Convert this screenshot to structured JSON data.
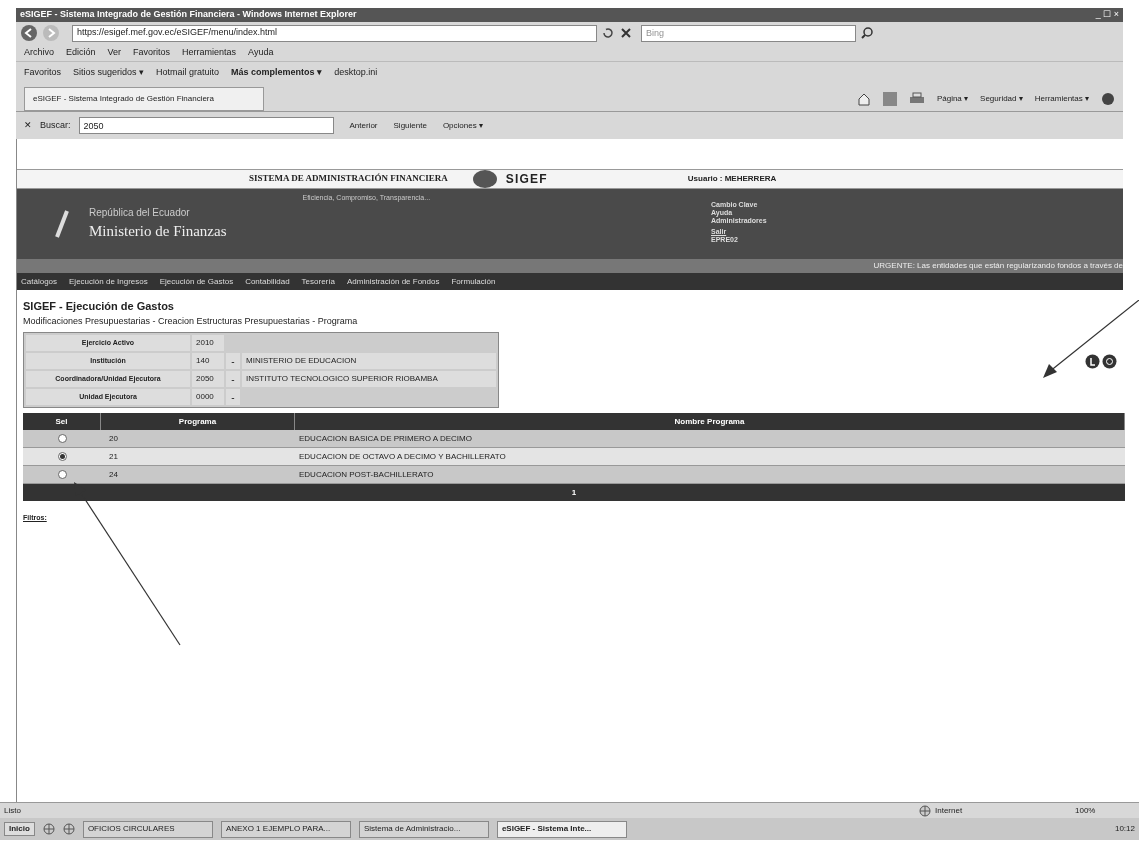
{
  "window": {
    "title": "eSIGEF - Sistema Integrado de Gestión Financiera - Windows Internet Explorer",
    "controls": "_ ☐ ×"
  },
  "address_bar": {
    "url": "https://esigef.mef.gov.ec/eSIGEF/menu/index.html",
    "search_placeholder": "Bing"
  },
  "menu": [
    "Archivo",
    "Edición",
    "Ver",
    "Favoritos",
    "Herramientas",
    "Ayuda"
  ],
  "favorites_bar": {
    "label": "Favoritos",
    "links": [
      {
        "label": "Sitios sugeridos ▾",
        "bold": false
      },
      {
        "label": "Hotmail gratuito",
        "bold": false
      },
      {
        "label": "Más complementos ▾",
        "bold": true
      },
      {
        "label": "desktop.ini",
        "bold": false
      }
    ]
  },
  "tabs": [
    {
      "label": "eSIGEF - Sistema Integrado de Gestión Financiera",
      "selected": true
    }
  ],
  "command_bar": [
    "Página ▾",
    "Seguridad ▾",
    "Herramientas ▾"
  ],
  "find_bar": {
    "close": "✕",
    "label": "Buscar:",
    "value": "2050",
    "buttons": [
      "Anterior",
      "Siguiente",
      "Opciones ▾"
    ]
  },
  "page": {
    "system_title": "SISTEMA DE ADMINISTRACIÓN FINANCIERA",
    "logo": "SIGEF",
    "user": "Usuario : MEHERRERA",
    "banner": {
      "line1": "República del Ecuador",
      "line2": "Ministerio de Finanzas",
      "slogan": "Eficiencia, Compromiso, Transparencia..."
    },
    "user_links": [
      "Cambio Clave",
      "Ayuda",
      "Administradores",
      "Salir",
      "EPRE02"
    ],
    "notice": "URGENTE: Las entidades que están regularizando fondos a través de",
    "nav": [
      "Catálogos",
      "Ejecución de Ingresos",
      "Ejecución de Gastos",
      "Contabilidad",
      "Tesorería",
      "Administración de Fondos",
      "Formulación"
    ],
    "heading": "SIGEF - Ejecución de Gastos",
    "breadcrumb": "Modificaciones Presupuestarias - Creacion Estructuras Presupuestarias - Programa",
    "info": [
      {
        "label": "Ejercicio Activo",
        "code": "2010"
      },
      {
        "label": "Institución",
        "code": "140",
        "separator": "-",
        "name": "MINISTERIO DE EDUCACION"
      },
      {
        "label": "Coordinadora/Unidad Ejecutora",
        "code": "2050",
        "separator": "-",
        "name": "INSTITUTO TECNOLOGICO SUPERIOR RIOBAMBA"
      },
      {
        "label": "Unidad Ejecutora",
        "code": "0000",
        "separator": "-"
      }
    ],
    "table": {
      "columns": [
        "Sel",
        "Programa",
        "Nombre Programa"
      ],
      "rows": [
        {
          "code": "20",
          "name": "EDUCACION BASICA DE PRIMERO A DECIMO",
          "selected": false
        },
        {
          "code": "21",
          "name": "EDUCACION DE OCTAVO A DECIMO Y BACHILLERATO",
          "selected": true
        },
        {
          "code": "24",
          "name": "EDUCACION POST-BACHILLERATO",
          "selected": false
        }
      ],
      "page": "1"
    },
    "filters_link": "Filtros:"
  },
  "status_bar": {
    "text": "Listo",
    "zone": "Internet",
    "zoom": "100%"
  },
  "taskbar": {
    "start": "Inicio",
    "items": [
      {
        "label": "OFICIOS CIRCULARES",
        "selected": false
      },
      {
        "label": "ANEXO 1 EJEMPLO PARA...",
        "selected": false
      },
      {
        "label": "Sistema de Administracio...",
        "selected": false
      },
      {
        "label": "eSIGEF - Sistema Inte...",
        "selected": true
      }
    ],
    "clock": "10:12"
  }
}
